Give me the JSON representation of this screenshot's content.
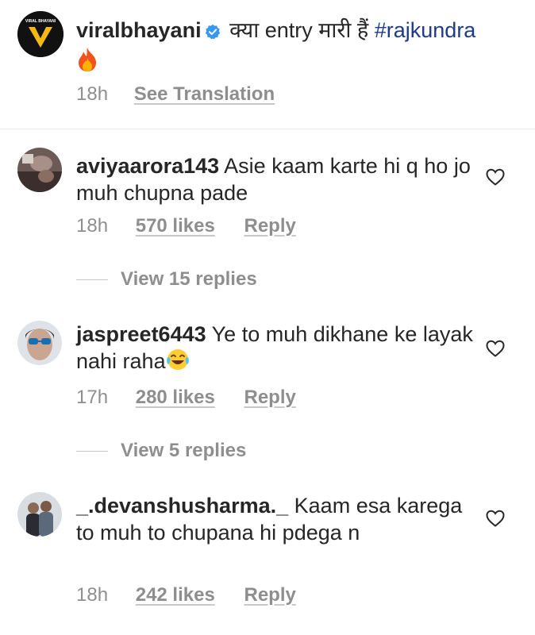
{
  "caption": {
    "username": "viralbhayani",
    "text": "क्या entry मारी हैं",
    "hashtag": "#rajkundra",
    "emoji_icon": "fire-emoji",
    "time": "18h",
    "see_translation": "See Translation",
    "avatar_label": "VIRAL BHAYANI"
  },
  "comments": [
    {
      "username": "aviyaarora143",
      "text": "Asie kaam karte hi q ho jo muh chupna  pade",
      "time": "18h",
      "likes": "570 likes",
      "reply": "Reply",
      "view_replies": "View 15 replies"
    },
    {
      "username": "jaspreet6443",
      "text": "Ye to muh dikhane ke layak nahi raha",
      "emoji_icon": "laughing-tears-emoji",
      "time": "17h",
      "likes": "280 likes",
      "reply": "Reply",
      "view_replies": "View 5 replies"
    },
    {
      "username": "_.devanshusharma._",
      "text": "Kaam esa karega to muh to chupana hi pdega n",
      "time": "18h",
      "likes": "242 likes",
      "reply": "Reply"
    }
  ],
  "colors": {
    "text": "#262626",
    "muted": "#8e8e8e",
    "hashtag": "#1e3a8a",
    "verified": "#3897f0",
    "avatar_logo": "#f5b915"
  }
}
